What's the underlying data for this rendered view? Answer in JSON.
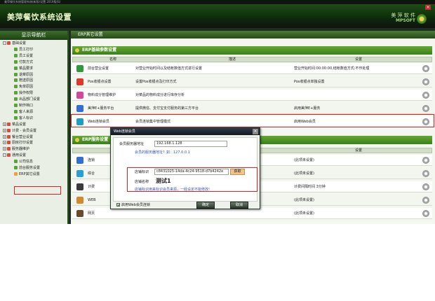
{
  "window": {
    "title": "美萍餐饮系统设置",
    "close_symbol": "×",
    "logo_main": "美 萍 软 件",
    "logo_sub": "MPSOFT",
    "os_caption": "美萍餐饮系统管理系统(新版)设置 2019版(S)"
  },
  "sidebar": {
    "title": "显示导航栏",
    "items": [
      {
        "label": "基础设置",
        "level": 0,
        "icon": "red",
        "exp": "−"
      },
      {
        "label": "员工打印",
        "level": 1,
        "icon": "green"
      },
      {
        "label": "员工设置",
        "level": 1,
        "icon": "green"
      },
      {
        "label": "付款方式",
        "level": 1,
        "icon": "green"
      },
      {
        "label": "菜品要求",
        "level": 1,
        "icon": "green"
      },
      {
        "label": "退菜原因",
        "level": 1,
        "icon": "green"
      },
      {
        "label": "赠送原因",
        "level": 1,
        "icon": "green"
      },
      {
        "label": "免单原因",
        "level": 1,
        "icon": "green"
      },
      {
        "label": "操作权限",
        "level": 1,
        "icon": "green"
      },
      {
        "label": "出品部门设置",
        "level": 1,
        "icon": "green"
      },
      {
        "label": "制作档口",
        "level": 1,
        "icon": "green"
      },
      {
        "label": "客人来源",
        "level": 1,
        "icon": "green"
      },
      {
        "label": "客人标识",
        "level": 1,
        "icon": "green"
      },
      {
        "label": "菜品设置",
        "level": 0,
        "icon": "red",
        "exp": "+"
      },
      {
        "label": "计费 - 会员设置",
        "level": 0,
        "icon": "red",
        "exp": "+"
      },
      {
        "label": "餐台营业设置",
        "level": 0,
        "icon": "red",
        "exp": "+"
      },
      {
        "label": "厨房打印设置",
        "level": 0,
        "icon": "red",
        "exp": "+"
      },
      {
        "label": "服务器维护",
        "level": 0,
        "icon": "red",
        "exp": "+"
      },
      {
        "label": "通用设置",
        "level": 0,
        "icon": "red",
        "exp": "−"
      },
      {
        "label": "公司信息",
        "level": 1,
        "icon": "green"
      },
      {
        "label": "前台服务设置",
        "level": 1,
        "icon": "green"
      },
      {
        "label": "ERP其它设置",
        "level": 1,
        "icon": "orange"
      }
    ]
  },
  "main": {
    "header": "ERP其它设置",
    "section1": {
      "title": "ERP基础参数设置",
      "headers": {
        "name": "名称",
        "desc": "描述",
        "setting": "设置"
      },
      "rows": [
        {
          "name": "前台营业设置",
          "desc": "对营业开始时间以及结帐数值方式进行设置",
          "setting": "营业开始时间:00:00:00,结帐数值方式:不作处理",
          "icon": "#2e9a3a"
        },
        {
          "name": "Pos收银点设置",
          "desc": "设置Pos收银点及打印方式",
          "setting": "Pos收银点单独设置",
          "icon": "#e0372b"
        },
        {
          "name": "物料成分管理维护",
          "desc": "对菜品的物料成分进行库存分析",
          "setting": "",
          "icon": "#d6459a"
        },
        {
          "name": "美萍E+服务平台",
          "desc": "提供微信、支付宝支付服务的第三方平台",
          "setting": "启用美萍E+服务",
          "icon": "#2f6fd6"
        },
        {
          "name": "Web连锁会员",
          "desc": "会员连锁集中管理模式",
          "setting": "启用Web会员",
          "icon": "#1b9fc4"
        }
      ]
    },
    "section2": {
      "title": "ERP服务设置",
      "headers": {
        "setting": "设置"
      },
      "rows": [
        {
          "name": "连锁",
          "setting": "(此项未设置)",
          "icon": "#2f6fd6"
        },
        {
          "name": "综合",
          "setting": "(此项未设置)",
          "icon": "#27a0d6"
        },
        {
          "name": "计费",
          "setting": "计费间隔时间 3分钟",
          "icon": "#3b3b3b"
        },
        {
          "name": "WEB",
          "setting": "(此项未设置)",
          "icon": "#d4872b"
        },
        {
          "name": "网页",
          "setting": "(此项未设置)",
          "icon": "#6a4a2b"
        }
      ]
    }
  },
  "dialog": {
    "title": "Web连锁会员",
    "server_label": "会员服务器地址",
    "server_value": "192.168.1.128",
    "server_hint": "会员的服务器地址？如：127.0.0.1",
    "store_id_label": "店铺标识",
    "store_id_value": "c8431025-14da-4c24-9518-d7b4242e",
    "get_button": "获取",
    "store_name_label": "店铺名称",
    "store_name_value": "测试1",
    "store_hint": "店铺标识用来标识会员来源，一经设定不能修改!",
    "enable_label": "启用Web会员连锁",
    "ok": "确定",
    "cancel": "取消"
  }
}
